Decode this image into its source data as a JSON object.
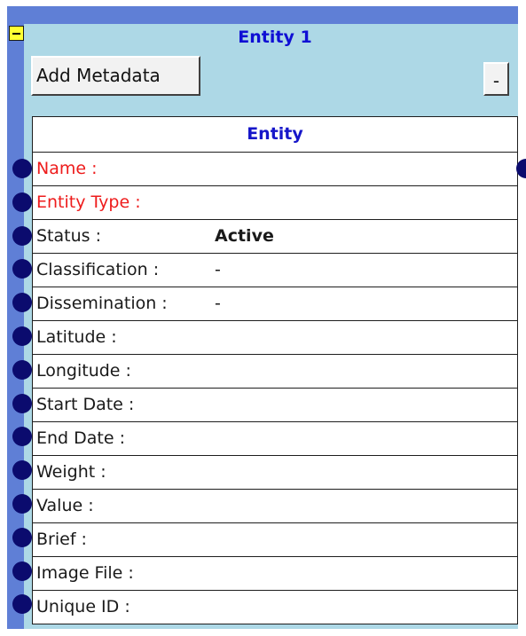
{
  "node": {
    "title": "Entity 1",
    "add_metadata_label": "Add Metadata",
    "minus_label": "-",
    "colors": {
      "frame": "#5f7fd6",
      "body": "#add8e6",
      "title": "#0f0fd4",
      "required": "#ee1c1c",
      "port": "#0b0b6e"
    }
  },
  "table": {
    "header": "Entity",
    "rows": [
      {
        "label": "Name :",
        "value": "",
        "required": true
      },
      {
        "label": "Entity Type :",
        "value": "",
        "required": true
      },
      {
        "label": "Status :",
        "value": "Active",
        "required": false
      },
      {
        "label": "Classification :",
        "value": "-",
        "required": false
      },
      {
        "label": "Dissemination :",
        "value": "-",
        "required": false
      },
      {
        "label": "Latitude :",
        "value": "",
        "required": false
      },
      {
        "label": "Longitude :",
        "value": "",
        "required": false
      },
      {
        "label": "Start Date :",
        "value": "",
        "required": false
      },
      {
        "label": "End Date :",
        "value": "",
        "required": false
      },
      {
        "label": "Weight :",
        "value": "",
        "required": false
      },
      {
        "label": "Value :",
        "value": "",
        "required": false
      },
      {
        "label": "Brief :",
        "value": "",
        "required": false
      },
      {
        "label": "Image File :",
        "value": "",
        "required": false
      },
      {
        "label": "Unique ID :",
        "value": "",
        "required": false
      }
    ]
  }
}
